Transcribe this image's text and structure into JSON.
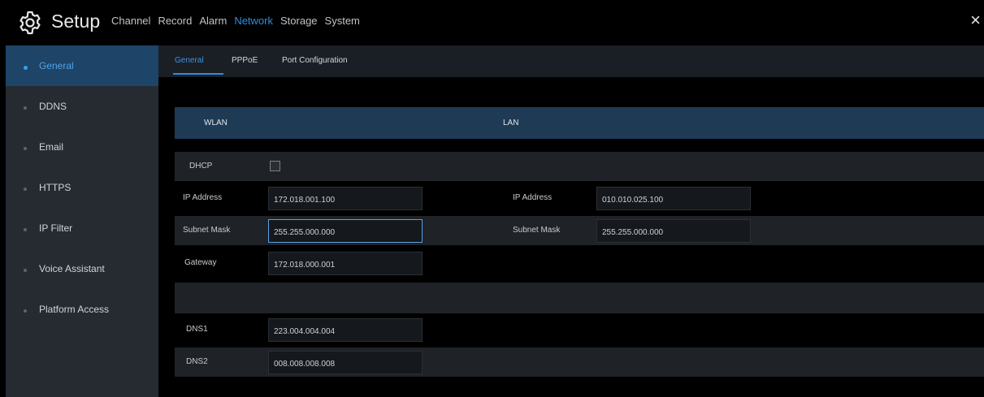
{
  "header": {
    "title": "Setup",
    "icon": "gear-icon",
    "menu": [
      {
        "label": "Channel",
        "active": false
      },
      {
        "label": "Record",
        "active": false
      },
      {
        "label": "Alarm",
        "active": false
      },
      {
        "label": "Network",
        "active": true
      },
      {
        "label": "Storage",
        "active": false
      },
      {
        "label": "System",
        "active": false
      }
    ],
    "close_label": "×"
  },
  "sidebar": {
    "items": [
      {
        "label": "General",
        "active": true
      },
      {
        "label": "DDNS",
        "active": false
      },
      {
        "label": "Email",
        "active": false
      },
      {
        "label": "HTTPS",
        "active": false
      },
      {
        "label": "IP Filter",
        "active": false
      },
      {
        "label": "Voice Assistant",
        "active": false
      },
      {
        "label": "Platform Access",
        "active": false
      }
    ]
  },
  "subtabs": [
    {
      "label": "General",
      "active": true
    },
    {
      "label": "PPPoE",
      "active": false
    },
    {
      "label": "Port Configuration",
      "active": false
    }
  ],
  "sections": {
    "wlan": "WLAN",
    "lan": "LAN"
  },
  "wlan": {
    "dhcp_label": "DHCP",
    "dhcp_checked": false,
    "ip_label": "IP Address",
    "ip_value": "172.018.001.100",
    "mask_label": "Subnet Mask",
    "mask_value": "255.255.000.000",
    "gateway_label": "Gateway",
    "gateway_value": "172.018.000.001"
  },
  "lan": {
    "ip_label": "IP Address",
    "ip_value": "010.010.025.100",
    "mask_label": "Subnet Mask",
    "mask_value": "255.255.000.000"
  },
  "dns": {
    "dns1_label": "DNS1",
    "dns1_value": "223.004.004.004",
    "dns2_label": "DNS2",
    "dns2_value": "008.008.008.008"
  },
  "colors": {
    "accent": "#2e8ee0",
    "sidebar_bg": "#262b32",
    "sidebar_active_bg": "#1e4467",
    "section_header_bg": "#1e3a55",
    "row_bg": "#1f2226"
  }
}
